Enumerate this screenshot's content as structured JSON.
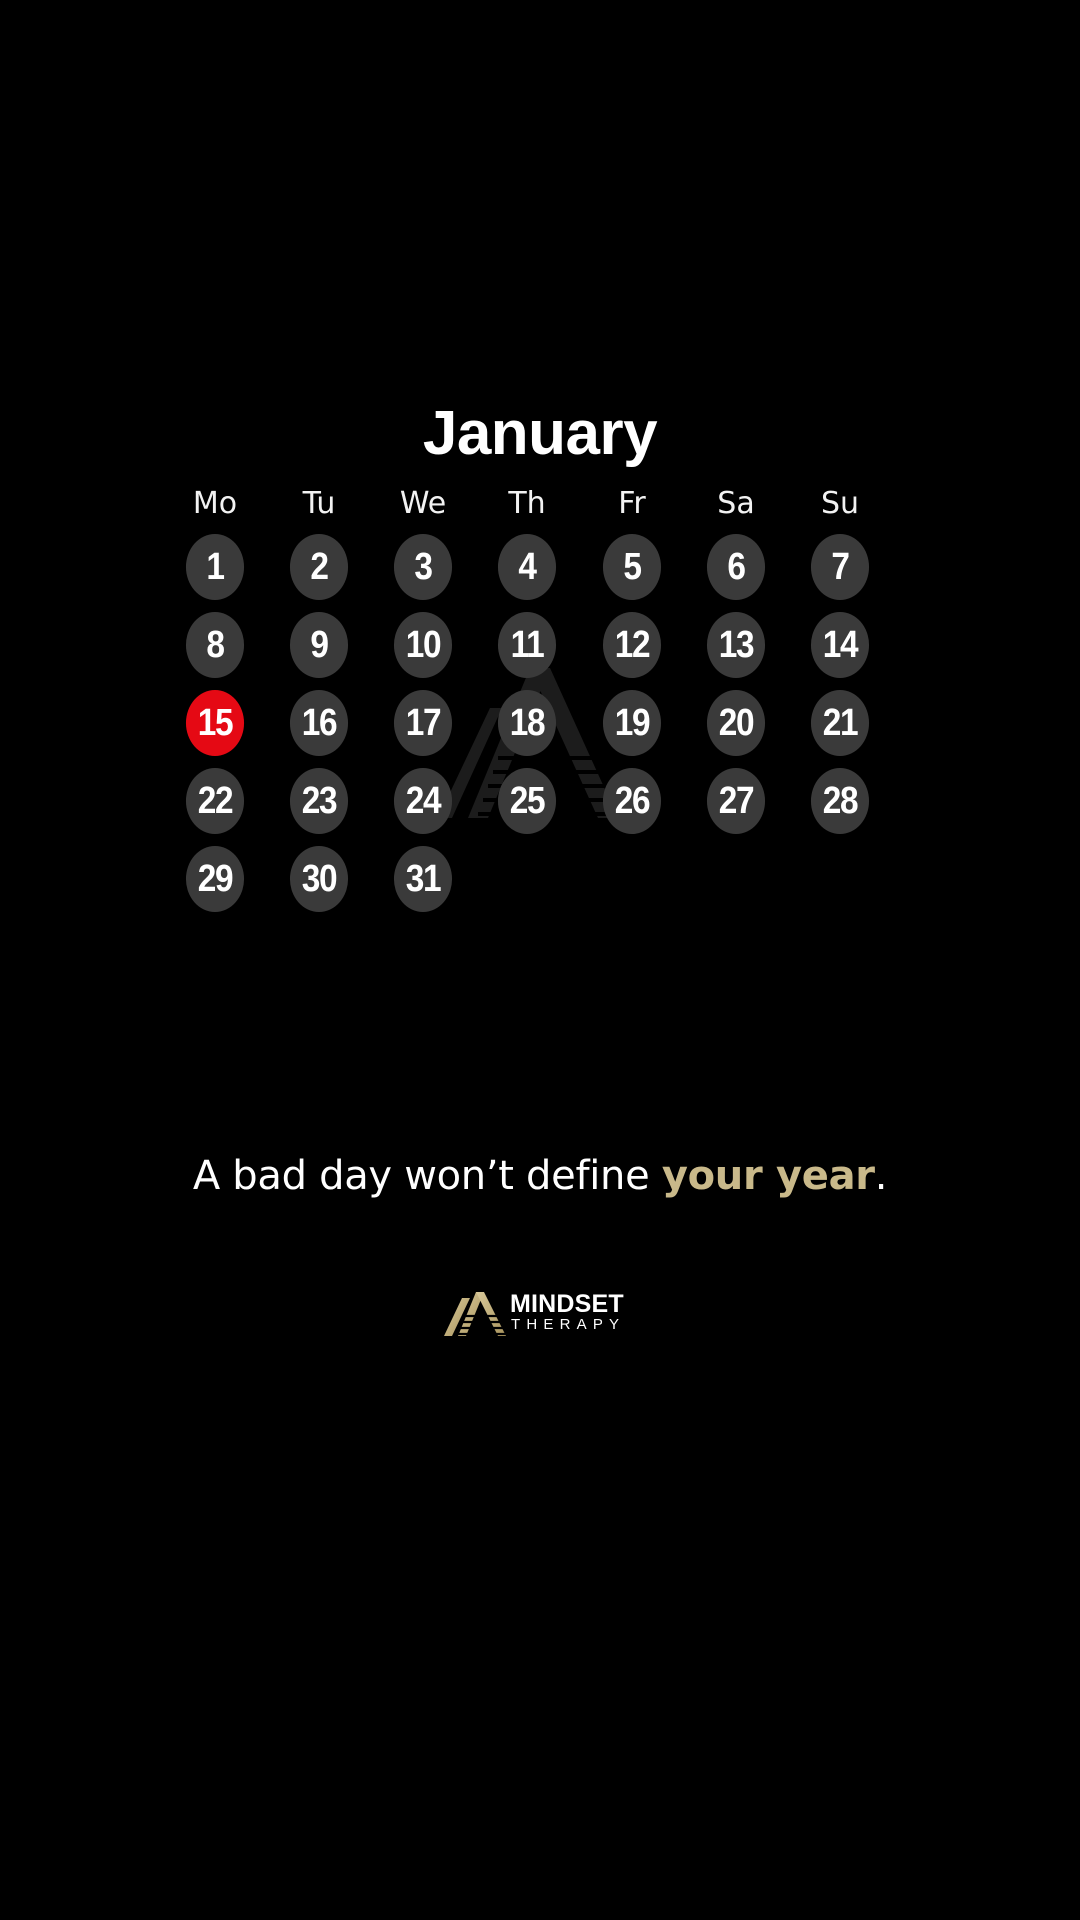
{
  "calendar": {
    "month": "January",
    "weekdays": [
      "Mo",
      "Tu",
      "We",
      "Th",
      "Fr",
      "Sa",
      "Su"
    ],
    "first_weekday_index": 0,
    "days_in_month": 31,
    "highlighted_day": 15
  },
  "quote": {
    "prefix": "A bad day won’t define ",
    "accent": "your year",
    "suffix": "."
  },
  "logo": {
    "line1": "MINDSET",
    "line2": "THERAPY"
  },
  "colors": {
    "background": "#000000",
    "day_circle": "#3a3a3a",
    "today_circle": "#e50914",
    "accent_gold": "#c9b98a",
    "text": "#ffffff"
  },
  "icons": {
    "watermark": "mindset-mountain-logo-icon",
    "brand": "mindset-mountain-logo-icon"
  }
}
